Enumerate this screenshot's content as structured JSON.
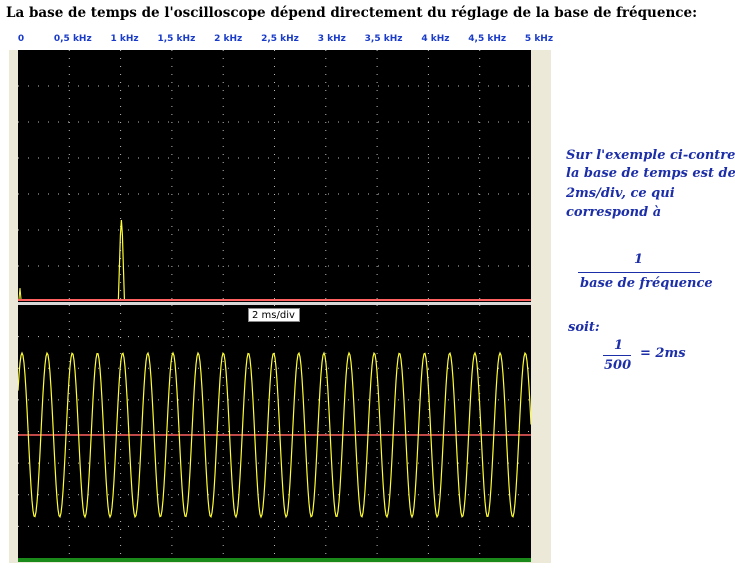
{
  "title": "La base de temps de l'oscilloscope dépend directement du réglage de la base de fréquence:",
  "freq_axis": {
    "labels": [
      "0",
      "0,5 kHz",
      "1 kHz",
      "1,5 kHz",
      "2 kHz",
      "2,5 kHz",
      "3 kHz",
      "3,5 kHz",
      "4 kHz",
      "4,5 kHz",
      "5 kHz"
    ]
  },
  "spectrum": {
    "peak_frequency_khz": 1,
    "colors": {
      "trace": "#ffff33",
      "grid": "#bbbbbb",
      "baseline": "#ff6060"
    }
  },
  "oscilloscope": {
    "timebase_label": "2 ms/div",
    "cycles_shown": 20,
    "colors": {
      "trace": "#ffff33",
      "zero_line": "#ff6060"
    }
  },
  "notes": {
    "line1": "Sur l'exemple ci-contre,",
    "line2": "la base de temps est de",
    "line3": "2ms/div, ce qui",
    "line4": "correspond à",
    "fraction_numerator": "1",
    "fraction_denominator": "base de fréquence",
    "soit_label": "soit:",
    "result_numerator": "1",
    "result_denominator": "500",
    "result_value": "=  2ms"
  }
}
